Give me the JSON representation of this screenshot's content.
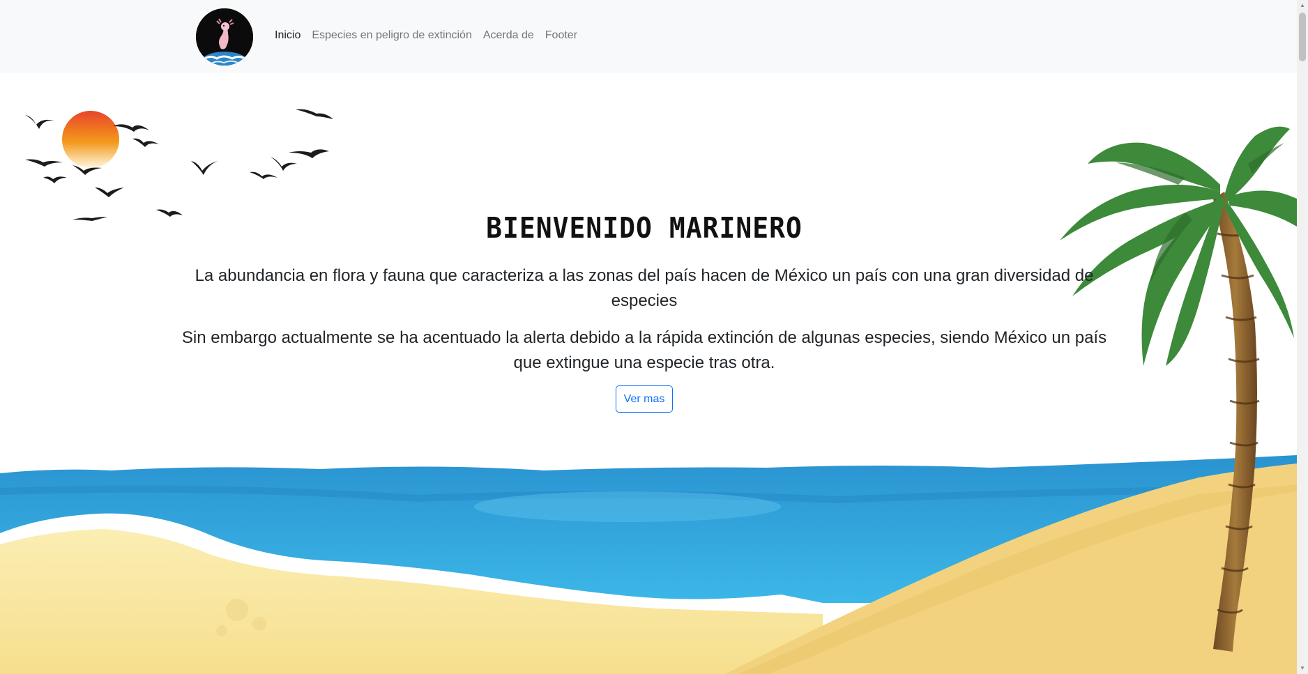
{
  "navbar": {
    "brand_icon": "axolotl-earth-logo",
    "links": [
      {
        "label": "Inicio",
        "active": true
      },
      {
        "label": "Especies en peligro de extinción",
        "active": false
      },
      {
        "label": "Acerda de",
        "active": false
      },
      {
        "label": "Footer",
        "active": false
      }
    ]
  },
  "hero": {
    "title": "BIENVENIDO MARINERO",
    "paragraph1": "La abundancia en flora y fauna que caracteriza a las zonas del país hacen de México un país con una gran diversidad de especies",
    "paragraph2": "Sin embargo actualmente se ha acentuado la alerta debido a la rápida extinción de algunas especies, siendo México un país que extingue una especie tras otra.",
    "button_label": "Ver mas"
  },
  "colors": {
    "navbar_bg": "#f8f9fa",
    "link_active": "#212529",
    "link_inactive": "#757575",
    "button_accent": "#0d6efd",
    "sea": "#2e9fd8",
    "sand": "#f2d27e",
    "palm_leaves": "#3c8a3a"
  }
}
